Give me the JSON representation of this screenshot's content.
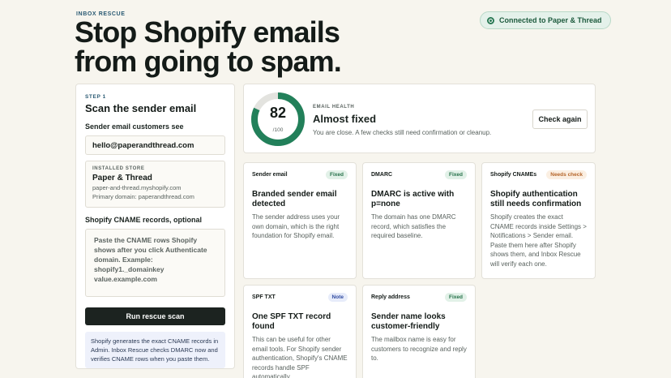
{
  "eyebrow": "INBOX RESCUE",
  "hero": {
    "line1": "Stop Shopify emails",
    "line2": "from going to spam."
  },
  "connection": {
    "label": "Connected to Paper & Thread"
  },
  "scan": {
    "step": "STEP 1",
    "title": "Scan the sender email",
    "sender_label": "Sender email customers see",
    "sender_value": "hello@paperandthread.com",
    "store": {
      "tag": "INSTALLED STORE",
      "name": "Paper & Thread",
      "domain": "paper-and-thread.myshopify.com",
      "primary": "Primary domain: paperandthread.com"
    },
    "cname_label": "Shopify CNAME records, optional",
    "cname_placeholder": "Paste the CNAME rows Shopify shows after you click Authenticate domain. Example: shopify1._domainkey value.example.com",
    "run_button": "Run rescue scan",
    "info": "Shopify generates the exact CNAME records in Admin. Inbox Rescue checks DMARC now and verifies CNAME rows when you paste them."
  },
  "health": {
    "score": "82",
    "score_value": 82,
    "of": "/100",
    "label": "EMAIL HEALTH",
    "status": "Almost fixed",
    "desc": "You are close. A few checks still need confirmation or cleanup.",
    "check_button": "Check again",
    "colors": {
      "ring": "#22805a",
      "track": "#e3e3df"
    }
  },
  "checks": [
    {
      "name": "Sender email",
      "badge": "Fixed",
      "title": "Branded sender email detected",
      "desc": "The sender address uses your own domain, which is the right foundation for Shopify email."
    },
    {
      "name": "DMARC",
      "badge": "Fixed",
      "title": "DMARC is active with p=none",
      "desc": "The domain has one DMARC record, which satisfies the required baseline."
    },
    {
      "name": "Shopify CNAMEs",
      "badge": "Needs check",
      "title": "Shopify authentication still needs confirmation",
      "desc": "Shopify creates the exact CNAME records inside Settings > Notifications > Sender email. Paste them here after Shopify shows them, and Inbox Rescue will verify each one."
    },
    {
      "name": "SPF TXT",
      "badge": "Note",
      "title": "One SPF TXT record found",
      "desc": "This can be useful for other email tools. For Shopify sender authentication, Shopify's CNAME records handle SPF automatically."
    },
    {
      "name": "Reply address",
      "badge": "Fixed",
      "title": "Sender name looks customer-friendly",
      "desc": "The mailbox name is easy for customers to recognize and reply to."
    }
  ]
}
